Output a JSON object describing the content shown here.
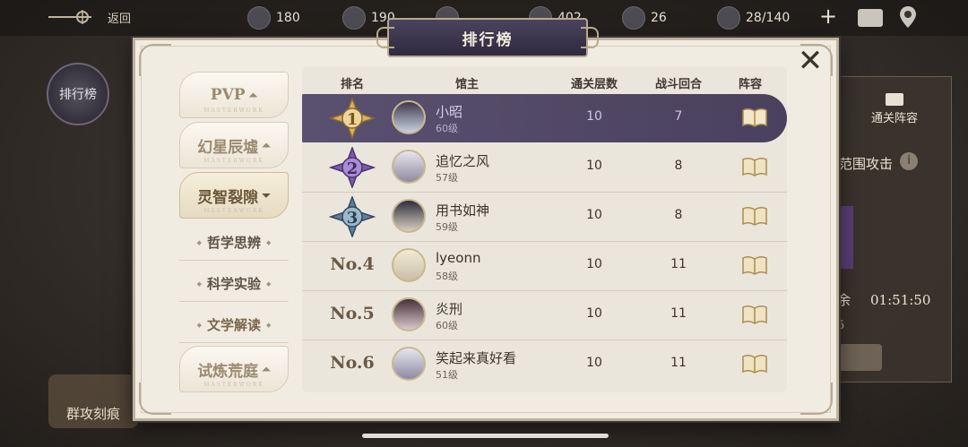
{
  "topbar": {
    "back_label": "返回",
    "resources": [
      {
        "name": "resource-1",
        "value": "180"
      },
      {
        "name": "resource-2",
        "value": "190"
      },
      {
        "name": "resource-3",
        "value": ""
      },
      {
        "name": "resource-4",
        "value": "402"
      },
      {
        "name": "resource-5",
        "value": "26"
      },
      {
        "name": "stamina",
        "value": "28/140"
      }
    ]
  },
  "background": {
    "left_button": "排行榜",
    "bottom_left_button": "群攻刻痕",
    "right_panel": {
      "formation_label": "通关阵容",
      "aoe_label": "范围攻击",
      "timer_prefix": "余",
      "timer": "01:51:50",
      "small_value": "5"
    }
  },
  "modal": {
    "title": "排行榜",
    "tabs": [
      {
        "label": "PVP",
        "arrow": "⏶"
      },
      {
        "label": "幻星辰墟",
        "arrow": "⏶"
      },
      {
        "label": "灵智裂隙",
        "arrow": "⏷"
      }
    ],
    "tab_watermark": "MASTERWORK",
    "subtabs": [
      "哲学思辨",
      "科学实验",
      "文学解读"
    ],
    "bottom_tab": {
      "label": "试炼荒庭",
      "arrow": "⏶"
    },
    "columns": [
      "排名",
      "馆主",
      "通关层数",
      "战斗回合",
      "阵容"
    ],
    "rows": [
      {
        "rank": "1",
        "name": "小昭",
        "level": "60级",
        "floors": "10",
        "rounds": "7"
      },
      {
        "rank": "2",
        "name": "追忆之风",
        "level": "57级",
        "floors": "10",
        "rounds": "8"
      },
      {
        "rank": "3",
        "name": "用书如神",
        "level": "59级",
        "floors": "10",
        "rounds": "8"
      },
      {
        "rank": "No.4",
        "name": "lyeonn",
        "level": "58级",
        "floors": "10",
        "rounds": "11"
      },
      {
        "rank": "No.5",
        "name": "炎刑",
        "level": "60级",
        "floors": "10",
        "rounds": "11"
      },
      {
        "rank": "No.6",
        "name": "笑起来真好看",
        "level": "51级",
        "floors": "10",
        "rounds": "11"
      }
    ]
  },
  "colors": {
    "highlight_row": "#4f4665",
    "gold": "#c9a25a",
    "silver_purple": "#7b5bb0",
    "bronze_blue": "#5f7f9c"
  }
}
